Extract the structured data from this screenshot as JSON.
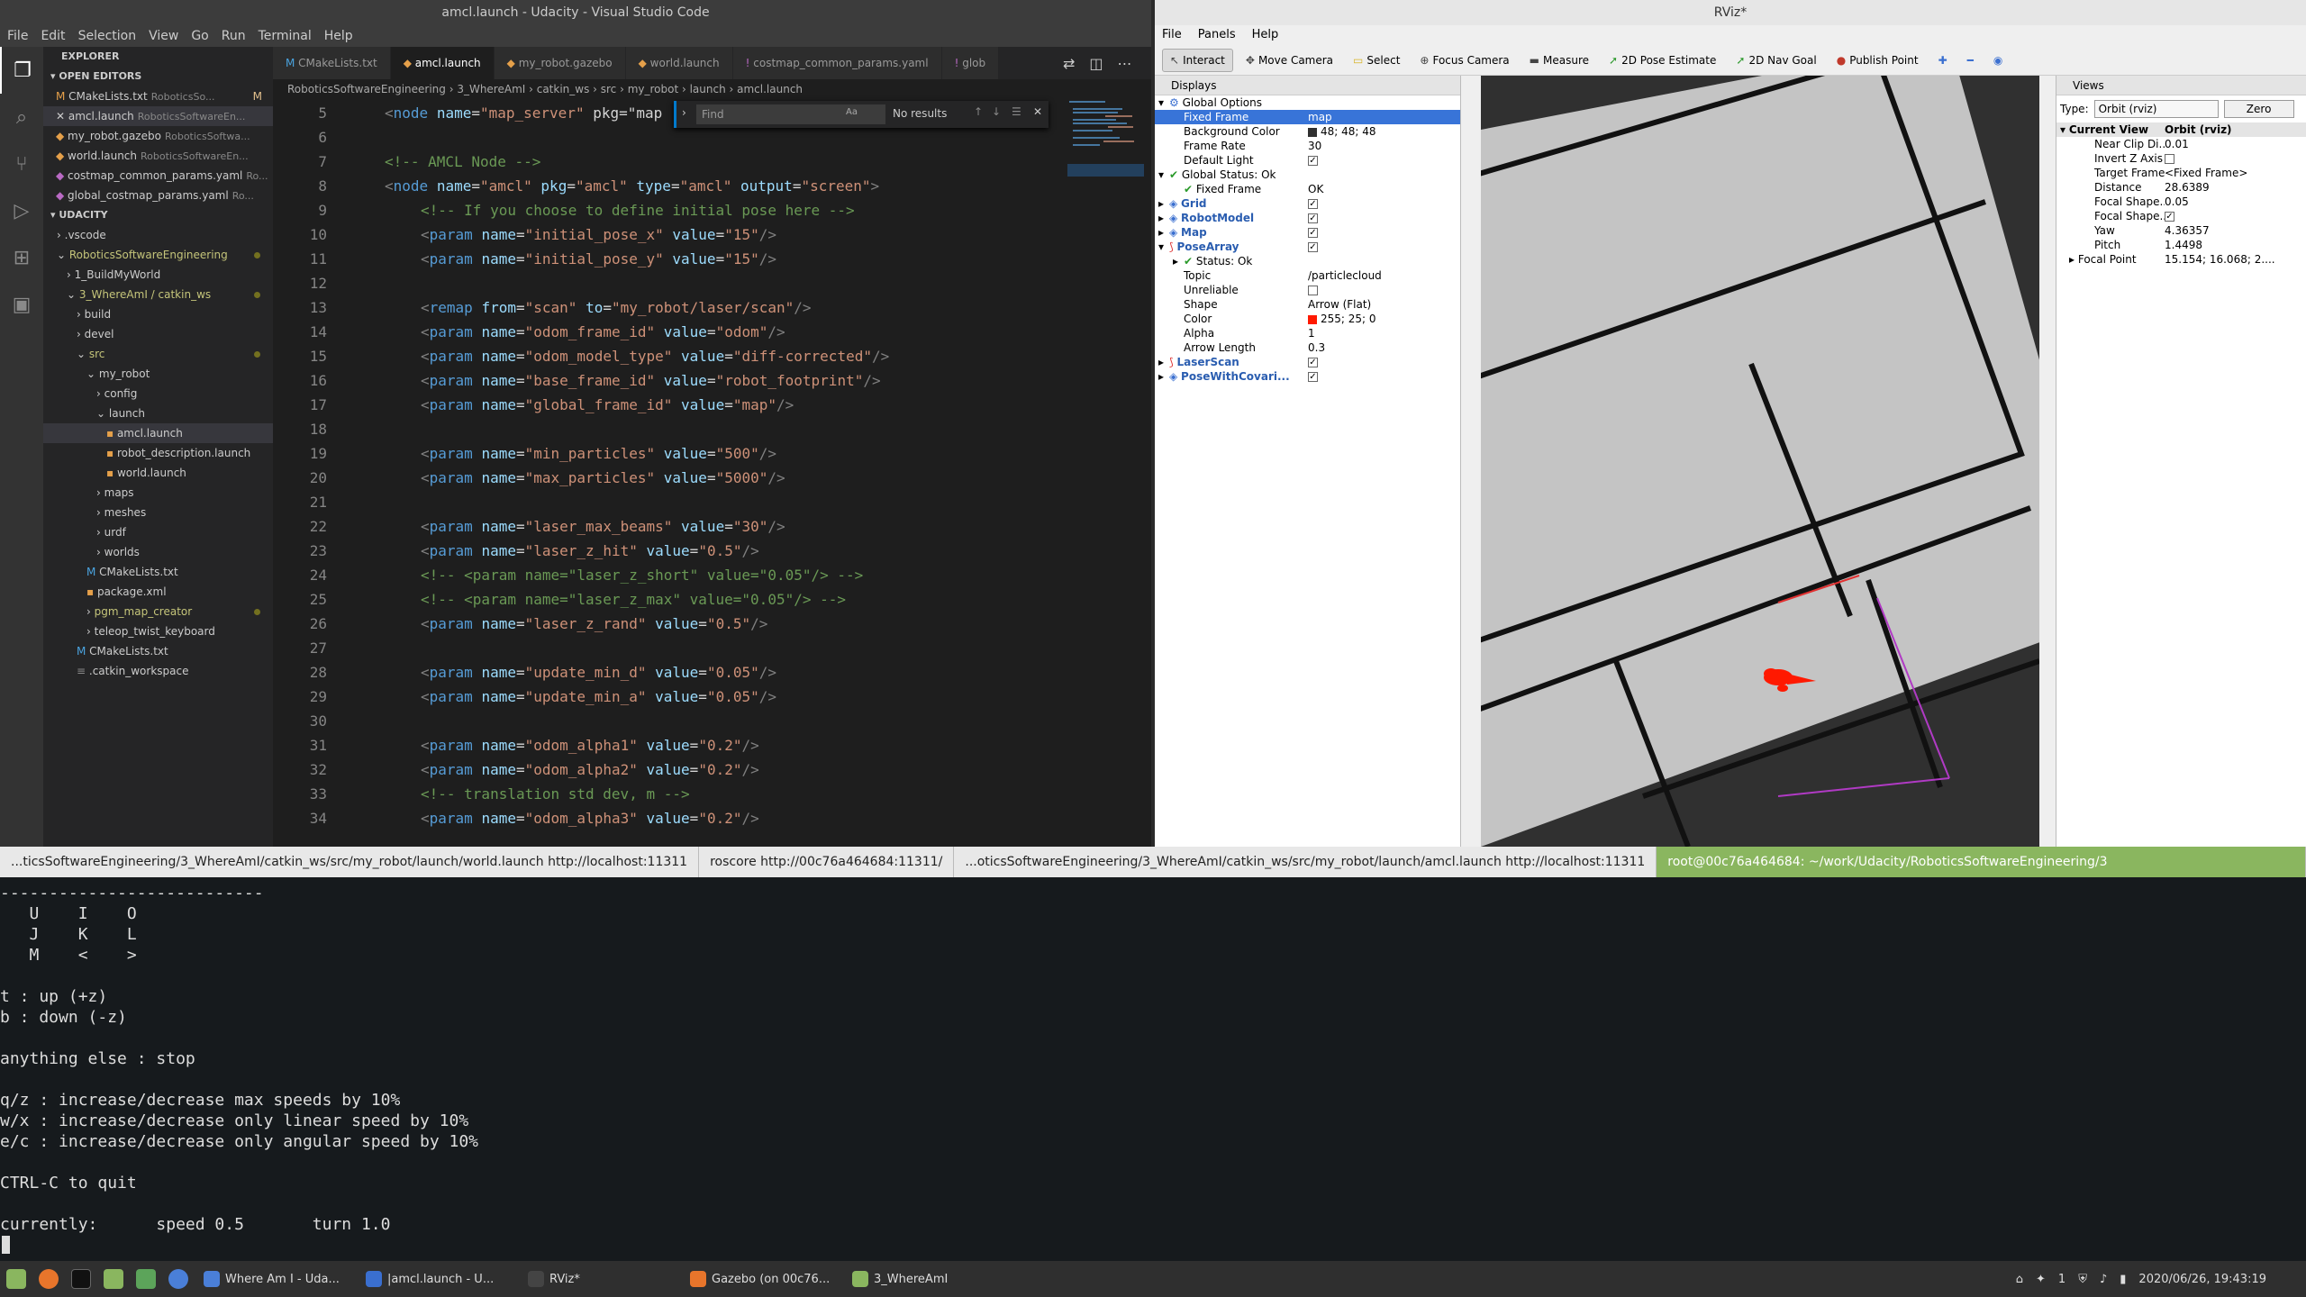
{
  "vscode": {
    "title": "amcl.launch - Udacity - Visual Studio Code",
    "menu": [
      "File",
      "Edit",
      "Selection",
      "View",
      "Go",
      "Run",
      "Terminal",
      "Help"
    ],
    "explorer_label": "EXPLORER",
    "open_editors_label": "OPEN EDITORS",
    "open_editors": [
      {
        "name": "CMakeLists.txt",
        "path": "RoboticsSo...",
        "badge": "M"
      },
      {
        "name": "amcl.launch",
        "path": "RoboticsSoftwareEn..."
      },
      {
        "name": "my_robot.gazebo",
        "path": "RoboticsSoftwa..."
      },
      {
        "name": "world.launch",
        "path": "RoboticsSoftwareEn..."
      },
      {
        "name": "costmap_common_params.yaml",
        "path": "Ro..."
      },
      {
        "name": "global_costmap_params.yaml",
        "path": "Ro..."
      }
    ],
    "workspace_label": "UDACITY",
    "tree": [
      {
        "label": ".vscode",
        "indent": 1,
        "kind": "folder"
      },
      {
        "label": "RoboticsSoftwareEngineering",
        "indent": 1,
        "kind": "folder-open",
        "dot": true
      },
      {
        "label": "1_BuildMyWorld",
        "indent": 2,
        "kind": "folder"
      },
      {
        "label": "3_WhereAmI / catkin_ws",
        "indent": 2,
        "kind": "folder-open",
        "dot": true
      },
      {
        "label": "build",
        "indent": 3,
        "kind": "folder"
      },
      {
        "label": "devel",
        "indent": 3,
        "kind": "folder"
      },
      {
        "label": "src",
        "indent": 3,
        "kind": "folder-open",
        "dot": true
      },
      {
        "label": "my_robot",
        "indent": 4,
        "kind": "folder-open"
      },
      {
        "label": "config",
        "indent": 5,
        "kind": "folder"
      },
      {
        "label": "launch",
        "indent": 5,
        "kind": "folder-open"
      },
      {
        "label": "amcl.launch",
        "indent": 6,
        "kind": "file",
        "selected": true
      },
      {
        "label": "robot_description.launch",
        "indent": 6,
        "kind": "file"
      },
      {
        "label": "world.launch",
        "indent": 6,
        "kind": "file"
      },
      {
        "label": "maps",
        "indent": 5,
        "kind": "folder"
      },
      {
        "label": "meshes",
        "indent": 5,
        "kind": "folder"
      },
      {
        "label": "urdf",
        "indent": 5,
        "kind": "folder"
      },
      {
        "label": "worlds",
        "indent": 5,
        "kind": "folder"
      },
      {
        "label": "CMakeLists.txt",
        "indent": 4,
        "kind": "cmake"
      },
      {
        "label": "package.xml",
        "indent": 4,
        "kind": "file"
      },
      {
        "label": "pgm_map_creator",
        "indent": 4,
        "kind": "folder",
        "dot": true
      },
      {
        "label": "teleop_twist_keyboard",
        "indent": 4,
        "kind": "folder"
      },
      {
        "label": "CMakeLists.txt",
        "indent": 3,
        "kind": "cmake"
      },
      {
        "label": ".catkin_workspace",
        "indent": 3,
        "kind": "plain"
      }
    ],
    "tabs": [
      "CMakeLists.txt",
      "amcl.launch",
      "my_robot.gazebo",
      "world.launch",
      "costmap_common_params.yaml",
      "glob"
    ],
    "active_tab": "amcl.launch",
    "breadcrumb": "RoboticsSoftwareEngineering › 3_WhereAmI › catkin_ws › src › my_robot › launch › amcl.launch",
    "find": {
      "placeholder": "Find",
      "result": "No results"
    },
    "code_lines": [
      {
        "n": "5",
        "t": "<node name=\"map_server\" pkg=\"map",
        "indent": 1
      },
      {
        "n": "6",
        "t": "",
        "indent": 0
      },
      {
        "n": "7",
        "t": "<!-- AMCL Node -->",
        "indent": 1
      },
      {
        "n": "8",
        "t": "<node name=\"amcl\" pkg=\"amcl\" type=\"amcl\" output=\"screen\">",
        "indent": 1
      },
      {
        "n": "9",
        "t": "<!-- If you choose to define initial pose here -->",
        "indent": 2
      },
      {
        "n": "10",
        "t": "<param name=\"initial_pose_x\" value=\"15\"/>",
        "indent": 2
      },
      {
        "n": "11",
        "t": "<param name=\"initial_pose_y\" value=\"15\"/>",
        "indent": 2
      },
      {
        "n": "12",
        "t": "",
        "indent": 0
      },
      {
        "n": "13",
        "t": "<remap from=\"scan\" to=\"my_robot/laser/scan\"/>",
        "indent": 2
      },
      {
        "n": "14",
        "t": "<param name=\"odom_frame_id\" value=\"odom\"/>",
        "indent": 2
      },
      {
        "n": "15",
        "t": "<param name=\"odom_model_type\" value=\"diff-corrected\"/>",
        "indent": 2
      },
      {
        "n": "16",
        "t": "<param name=\"base_frame_id\" value=\"robot_footprint\"/>",
        "indent": 2
      },
      {
        "n": "17",
        "t": "<param name=\"global_frame_id\" value=\"map\"/>",
        "indent": 2
      },
      {
        "n": "18",
        "t": "",
        "indent": 0
      },
      {
        "n": "19",
        "t": "<param name=\"min_particles\" value=\"500\"/>",
        "indent": 2
      },
      {
        "n": "20",
        "t": "<param name=\"max_particles\" value=\"5000\"/>",
        "indent": 2
      },
      {
        "n": "21",
        "t": "",
        "indent": 0
      },
      {
        "n": "22",
        "t": "<param name=\"laser_max_beams\" value=\"30\"/>",
        "indent": 2
      },
      {
        "n": "23",
        "t": "<param name=\"laser_z_hit\" value=\"0.5\"/>",
        "indent": 2
      },
      {
        "n": "24",
        "t": "<!-- <param name=\"laser_z_short\" value=\"0.05\"/> -->",
        "indent": 2
      },
      {
        "n": "25",
        "t": "<!-- <param name=\"laser_z_max\" value=\"0.05\"/> -->",
        "indent": 2
      },
      {
        "n": "26",
        "t": "<param name=\"laser_z_rand\" value=\"0.5\"/>",
        "indent": 2
      },
      {
        "n": "27",
        "t": "",
        "indent": 0
      },
      {
        "n": "28",
        "t": "<param name=\"update_min_d\" value=\"0.05\"/>",
        "indent": 2
      },
      {
        "n": "29",
        "t": "<param name=\"update_min_a\" value=\"0.05\"/>",
        "indent": 2
      },
      {
        "n": "30",
        "t": "",
        "indent": 0
      },
      {
        "n": "31",
        "t": "<param name=\"odom_alpha1\" value=\"0.2\"/>",
        "indent": 2
      },
      {
        "n": "32",
        "t": "<param name=\"odom_alpha2\" value=\"0.2\"/>",
        "indent": 2
      },
      {
        "n": "33",
        "t": "<!-- translation std dev, m -->",
        "indent": 2
      },
      {
        "n": "34",
        "t": "<param name=\"odom_alpha3\" value=\"0.2\"/>",
        "indent": 2
      }
    ]
  },
  "rviz": {
    "title": "RViz*",
    "menu": [
      "File",
      "Panels",
      "Help"
    ],
    "toolbar": [
      "Interact",
      "Move Camera",
      "Select",
      "Focus Camera",
      "Measure",
      "2D Pose Estimate",
      "2D Nav Goal",
      "Publish Point"
    ],
    "displays_label": "Displays",
    "display_rows": [
      {
        "k": "Global Options",
        "v": "",
        "lvl": 0,
        "exp": "▾",
        "icon": "gear"
      },
      {
        "k": "Fixed Frame",
        "v": "map",
        "lvl": 1,
        "hl": true
      },
      {
        "k": "Background Color",
        "v": "48; 48; 48",
        "lvl": 1,
        "swatch": "#303030"
      },
      {
        "k": "Frame Rate",
        "v": "30",
        "lvl": 1
      },
      {
        "k": "Default Light",
        "v": "",
        "lvl": 1,
        "check": true
      },
      {
        "k": "Global Status: Ok",
        "v": "",
        "lvl": 0,
        "exp": "▾",
        "icon": "ok"
      },
      {
        "k": "Fixed Frame",
        "v": "OK",
        "lvl": 1,
        "icon": "ok"
      },
      {
        "k": "Grid",
        "v": "",
        "lvl": 0,
        "exp": "▸",
        "blue": true,
        "check": true
      },
      {
        "k": "RobotModel",
        "v": "",
        "lvl": 0,
        "exp": "▸",
        "blue": true,
        "check": true
      },
      {
        "k": "Map",
        "v": "",
        "lvl": 0,
        "exp": "▸",
        "blue": true,
        "check": true
      },
      {
        "k": "PoseArray",
        "v": "",
        "lvl": 0,
        "exp": "▾",
        "blue": true,
        "check": true,
        "iconred": true
      },
      {
        "k": "Status: Ok",
        "v": "",
        "lvl": 1,
        "exp": "▸",
        "icon": "ok"
      },
      {
        "k": "Topic",
        "v": "/particlecloud",
        "lvl": 1
      },
      {
        "k": "Unreliable",
        "v": "",
        "lvl": 1,
        "check": false
      },
      {
        "k": "Shape",
        "v": "Arrow (Flat)",
        "lvl": 1
      },
      {
        "k": "Color",
        "v": "255; 25; 0",
        "lvl": 1,
        "swatch": "#ff1900"
      },
      {
        "k": "Alpha",
        "v": "1",
        "lvl": 1
      },
      {
        "k": "Arrow Length",
        "v": "0.3",
        "lvl": 1
      },
      {
        "k": "LaserScan",
        "v": "",
        "lvl": 0,
        "exp": "▸",
        "blue": true,
        "check": true,
        "iconred": true
      },
      {
        "k": "PoseWithCovari...",
        "v": "",
        "lvl": 0,
        "exp": "▸",
        "blue": true,
        "check": true
      }
    ],
    "views_label": "Views",
    "views_type_label": "Type:",
    "views_type_value": "Orbit (rviz)",
    "views_zero": "Zero",
    "view_rows": [
      {
        "k": "Current View",
        "v": "Orbit (rviz)",
        "head": true
      },
      {
        "k": "Near Clip Di...",
        "v": "0.01"
      },
      {
        "k": "Invert Z Axis",
        "v": "",
        "check": false
      },
      {
        "k": "Target Frame",
        "v": "<Fixed Frame>"
      },
      {
        "k": "Distance",
        "v": "28.6389"
      },
      {
        "k": "Focal Shape...",
        "v": "0.05"
      },
      {
        "k": "Focal Shape...",
        "v": "",
        "check": true
      },
      {
        "k": "Yaw",
        "v": "4.36357"
      },
      {
        "k": "Pitch",
        "v": "1.4498"
      },
      {
        "k": "Focal Point",
        "v": "15.154; 16.068; 2....",
        "exp": "▸"
      }
    ]
  },
  "terminal_tabs": [
    "...ticsSoftwareEngineering/3_WhereAmI/catkin_ws/src/my_robot/launch/world.launch http://localhost:11311",
    "roscore http://00c76a464684:11311/",
    "...oticsSoftwareEngineering/3_WhereAmI/catkin_ws/src/my_robot/launch/amcl.launch http://localhost:11311",
    "root@00c76a464684: ~/work/Udacity/RoboticsSoftwareEngineering/3"
  ],
  "terminal_text": "---------------------------\n   U    I    O\n   J    K    L\n   M    <    >\n\nt : up (+z)\nb : down (-z)\n\nanything else : stop\n\nq/z : increase/decrease max speeds by 10%\nw/x : increase/decrease only linear speed by 10%\ne/c : increase/decrease only angular speed by 10%\n\nCTRL-C to quit\n\ncurrently:      speed 0.5       turn 1.0",
  "taskbar": {
    "windows": [
      "Where Am I - Uda...",
      "|amcl.launch - U...",
      "RViz*",
      "Gazebo (on 00c76...",
      "3_WhereAmI"
    ],
    "clock": "2020/06/26, 19:43:19",
    "workspace": "1"
  },
  "colors": {
    "accent": "#007acc",
    "terminal_active": "#8ab65f",
    "rviz_bg": "#303030",
    "particles": "#ff1900"
  }
}
